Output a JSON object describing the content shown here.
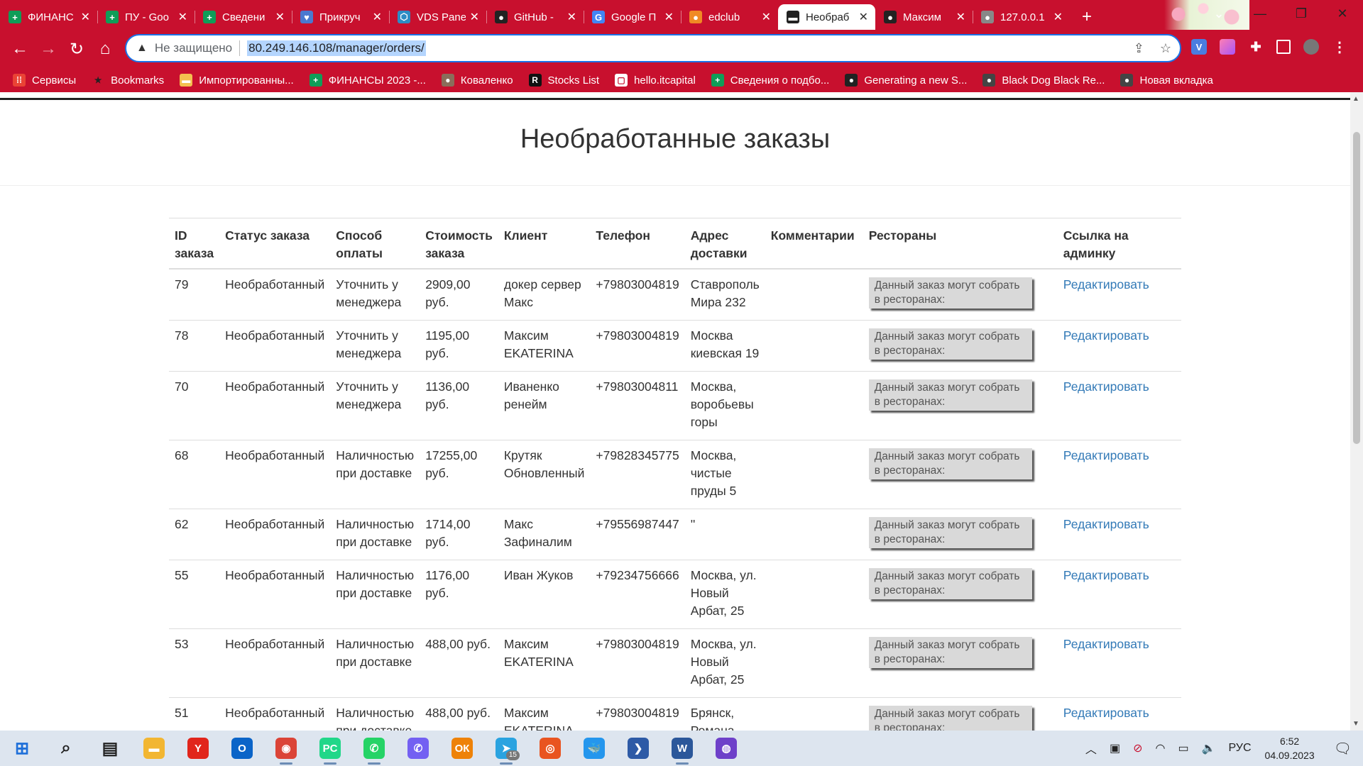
{
  "browser": {
    "tabs": [
      {
        "title": "ФИНАНС",
        "icon": "sheets-icon",
        "color": "#0f9d58",
        "active": false
      },
      {
        "title": "ПУ - Goo",
        "icon": "sheets-icon",
        "color": "#0f9d58",
        "active": false
      },
      {
        "title": "Сведени",
        "icon": "sheets-icon",
        "color": "#0f9d58",
        "active": false
      },
      {
        "title": "Прикруч",
        "icon": "heart-icon",
        "color": "#4a78d0",
        "active": false
      },
      {
        "title": "VDS Pane",
        "icon": "vds-icon",
        "color": "#2d8cc4",
        "active": false
      },
      {
        "title": "GitHub -",
        "icon": "github-icon",
        "color": "#222222",
        "active": false
      },
      {
        "title": "Google П",
        "icon": "translate-icon",
        "color": "#4285f4",
        "active": false
      },
      {
        "title": "edclub",
        "icon": "edclub-icon",
        "color": "#f08a24",
        "active": false
      },
      {
        "title": "Необраб",
        "icon": "site-icon",
        "color": "#222222",
        "active": true
      },
      {
        "title": "Максим",
        "icon": "github-icon",
        "color": "#222222",
        "active": false
      },
      {
        "title": "127.0.0.1",
        "icon": "globe-icon",
        "color": "#888888",
        "active": false
      }
    ],
    "omnibox": {
      "security_label": "Не защищено",
      "url": "80.249.146.108/manager/orders/"
    },
    "bookmarks": [
      {
        "label": "Сервисы",
        "icon": "apps-grid-icon",
        "color": "#ea4335"
      },
      {
        "label": "Bookmarks",
        "icon": "star-icon",
        "color": "#333333"
      },
      {
        "label": "Импортированны...",
        "icon": "folder-icon",
        "color": "#f4c04f"
      },
      {
        "label": "ФИНАНСЫ 2023 -...",
        "icon": "sheets-icon",
        "color": "#0f9d58"
      },
      {
        "label": "Коваленко",
        "icon": "avatar-icon",
        "color": "#8a6d5a"
      },
      {
        "label": "Stocks List",
        "icon": "stocks-icon",
        "color": "#111111"
      },
      {
        "label": "hello.itcapital",
        "icon": "page-icon",
        "color": "#ffffff"
      },
      {
        "label": "Сведения о подбо...",
        "icon": "sheets-icon",
        "color": "#0f9d58"
      },
      {
        "label": "Generating a new S...",
        "icon": "github-icon",
        "color": "#222222"
      },
      {
        "label": "Black Dog Black Re...",
        "icon": "globe-icon",
        "color": "#444444"
      },
      {
        "label": "Новая вкладка",
        "icon": "globe-icon",
        "color": "#444444"
      }
    ]
  },
  "page": {
    "title": "Необработанные заказы",
    "table": {
      "headers": {
        "id": "ID заказа",
        "status": "Статус заказа",
        "payment": "Способ оплаты",
        "cost": "Стоимость заказа",
        "client": "Клиент",
        "phone": "Телефон",
        "address": "Адрес доставки",
        "comments": "Комментарии",
        "restaurants": "Рестораны",
        "admin": "Ссылка на админку"
      },
      "rows": [
        {
          "id": "79",
          "status": "Необработанный",
          "payment": "Уточнить у менеджера",
          "cost": "2909,00 руб.",
          "client": "докер сервер Макс",
          "phone": "+79803004819",
          "address": "Ставрополь Мира 232",
          "comment": "",
          "restaurants": "Данный заказ могут собрать в ресторанах:",
          "admin": "Редактировать"
        },
        {
          "id": "78",
          "status": "Необработанный",
          "payment": "Уточнить у менеджера",
          "cost": "1195,00 руб.",
          "client": "Максим EKATERINA",
          "phone": "+79803004819",
          "address": "Москва киевская 19",
          "comment": "",
          "restaurants": "Данный заказ могут собрать в ресторанах:",
          "admin": "Редактировать"
        },
        {
          "id": "70",
          "status": "Необработанный",
          "payment": "Уточнить у менеджера",
          "cost": "1136,00 руб.",
          "client": "Иваненко ренейм",
          "phone": "+79803004811",
          "address": "Москва, воробьевы горы",
          "comment": "",
          "restaurants": "Данный заказ могут собрать в ресторанах:",
          "admin": "Редактировать"
        },
        {
          "id": "68",
          "status": "Необработанный",
          "payment": "Наличностью при доставке",
          "cost": "17255,00 руб.",
          "client": "Крутяк Обновленный",
          "phone": "+79828345775",
          "address": "Москва, чистые пруды 5",
          "comment": "",
          "restaurants": "Данный заказ могут собрать в ресторанах:",
          "admin": "Редактировать"
        },
        {
          "id": "62",
          "status": "Необработанный",
          "payment": "Наличностью при доставке",
          "cost": "1714,00 руб.",
          "client": "Макс Зафиналим",
          "phone": "+79556987447",
          "address": "''",
          "comment": "",
          "restaurants": "Данный заказ могут собрать в ресторанах:",
          "admin": "Редактировать"
        },
        {
          "id": "55",
          "status": "Необработанный",
          "payment": "Наличностью при доставке",
          "cost": "1176,00 руб.",
          "client": "Иван Жуков",
          "phone": "+79234756666",
          "address": "Москва, ул. Новый Арбат, 25",
          "comment": "",
          "restaurants": "Данный заказ могут собрать в ресторанах:",
          "admin": "Редактировать"
        },
        {
          "id": "53",
          "status": "Необработанный",
          "payment": "Наличностью при доставке",
          "cost": "488,00 руб.",
          "client": "Максим EKATERINA",
          "phone": "+79803004819",
          "address": "Москва, ул. Новый Арбат, 25",
          "comment": "",
          "restaurants": "Данный заказ могут собрать в ресторанах:",
          "admin": "Редактировать"
        },
        {
          "id": "51",
          "status": "Необработанный",
          "payment": "Наличностью при доставке",
          "cost": "488,00 руб.",
          "client": "Максим EKATERINA",
          "phone": "+79803004819",
          "address": "Брянск, Романа",
          "comment": "",
          "restaurants": "Данный заказ могут собрать в ресторанах:",
          "admin": "Редактировать"
        }
      ]
    }
  },
  "taskbar": {
    "apps": [
      {
        "name": "windows-start-icon",
        "color": "#1e6fd9"
      },
      {
        "name": "search-icon",
        "color": "#222222"
      },
      {
        "name": "task-view-icon",
        "color": "#222222"
      },
      {
        "name": "file-explorer-icon",
        "color": "#f2b632"
      },
      {
        "name": "yandex-browser-icon",
        "color": "#e1251b"
      },
      {
        "name": "outlook-icon",
        "color": "#0a64c8"
      },
      {
        "name": "chrome-icon",
        "color": "#db4437"
      },
      {
        "name": "pycharm-icon",
        "color": "#21d789"
      },
      {
        "name": "whatsapp-icon",
        "color": "#25d366"
      },
      {
        "name": "viber-icon",
        "color": "#7360f2"
      },
      {
        "name": "odnoklassniki-icon",
        "color": "#ee8208"
      },
      {
        "name": "telegram-icon",
        "color": "#2aa3e0"
      },
      {
        "name": "ubuntu-icon",
        "color": "#e95420"
      },
      {
        "name": "docker-icon",
        "color": "#2496ed"
      },
      {
        "name": "powershell-icon",
        "color": "#2d5aa6"
      },
      {
        "name": "word-icon",
        "color": "#2b579a"
      },
      {
        "name": "github-desktop-icon",
        "color": "#6e40c9"
      }
    ],
    "telegram_badge": "15",
    "tray": {
      "language": "РУС",
      "time": "6:52",
      "date": "04.09.2023"
    }
  }
}
